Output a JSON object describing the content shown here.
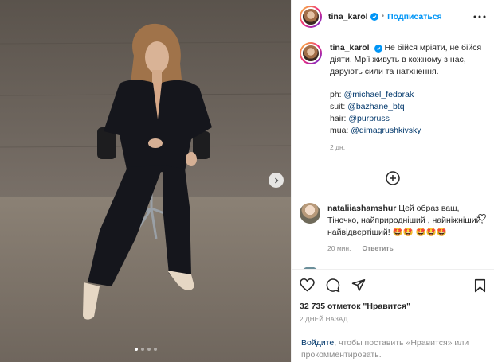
{
  "post": {
    "author": "tina_karol",
    "follow_label": "Подписаться",
    "separator": "•",
    "caption_text": "Не бійся мріяти, не бійся діяти. Мрії живуть в кожному з нас, дарують сили та натхнення.",
    "credits": [
      {
        "prefix": "ph:",
        "handle": "@michael_fedorak"
      },
      {
        "prefix": "suit:",
        "handle": "@bazhane_btq"
      },
      {
        "prefix": "hair:",
        "handle": "@purpruss"
      },
      {
        "prefix": "mua:",
        "handle": "@dimagrushkivsky"
      }
    ],
    "caption_age": "2 дн."
  },
  "comment": {
    "username": "nataliiashamshur",
    "text": "Цей образ ваш, Тіночко, найприроднiший , найніжніший, найвідвертіший! 🤩🤩 🤩🤩🤩",
    "age": "20 мин.",
    "reply_label": "Ответить"
  },
  "likes_text": "32 735 отметок \"Нравится\"",
  "date_text": "2 ДНЕЙ НАЗАД",
  "login": {
    "link": "Войдите",
    "text": ", чтобы поставить «Нравится» или прокомментировать."
  },
  "carousel": {
    "total": 4,
    "active_index": 0
  },
  "icons": [
    "more-icon",
    "verified-icon",
    "add-comment-icon",
    "heart-icon",
    "comment-icon",
    "share-icon",
    "save-icon",
    "chevron-right-icon"
  ],
  "colors": {
    "accent": "#0095f6",
    "link": "#00376b",
    "muted": "#8e8e8e",
    "text": "#262626"
  }
}
